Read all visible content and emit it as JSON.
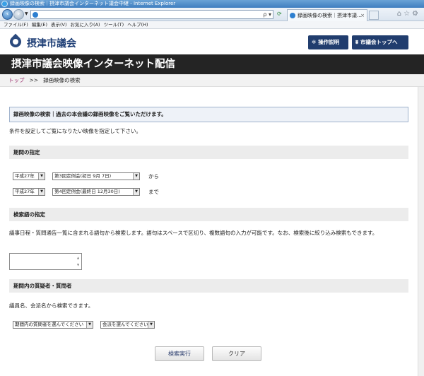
{
  "browser": {
    "title": "録画映像の検索｜摂津市議会インターネット議会中継 - Internet Explorer",
    "tab_label": "録画映像の検索｜摂津市議...",
    "tab_close": "×",
    "refresh_icon": "refresh-icon",
    "address_tools": "ρ ▾",
    "menu": [
      "ファイル(F)",
      "編集(E)",
      "表示(V)",
      "お気に入り(A)",
      "ツール(T)",
      "ヘルプ(H)"
    ]
  },
  "header": {
    "site_name": "摂津市議会",
    "help_button": "操作説明",
    "help_icon": "gear-icon",
    "top_button": "市議会トップへ",
    "top_icon": "sitemap-icon",
    "brand_color": "#213d6e"
  },
  "banner": {
    "title": "摂津市議会映像インターネット配信"
  },
  "breadcrumb": {
    "home": "トップ",
    "separator": ">>",
    "current": "録画映像の検索"
  },
  "intro": {
    "heading": "録画映像の検索｜過去の本会議の録画映像をご覧いただけます。",
    "subtext": "条件を設定してご覧になりたい映像を指定して下さい。"
  },
  "period": {
    "section_title": "期間の指定",
    "from_era": "平成27年",
    "from_meeting": "第3回定例会(初日 9月 7日)",
    "from_label": "から",
    "to_era": "平成27年",
    "to_meeting": "第4回定例会(最終日 12月30日)",
    "to_label": "まで"
  },
  "keyword": {
    "section_title": "検索語の指定",
    "description": "議事日程・質問通告一覧に含まれる語句から検索します。語句はスペースで区切り、複数語句の入力が可能です。なお、検索後に絞り込み検索もできます。",
    "value": ""
  },
  "people": {
    "section_title": "期間内の質疑者・質問者",
    "description": "議員名、会派名から検索できます。",
    "questioner_select": "期間内の質問者を選んでください",
    "party_select": "会派を選んでください"
  },
  "actions": {
    "search": "検索実行",
    "clear": "クリア"
  }
}
